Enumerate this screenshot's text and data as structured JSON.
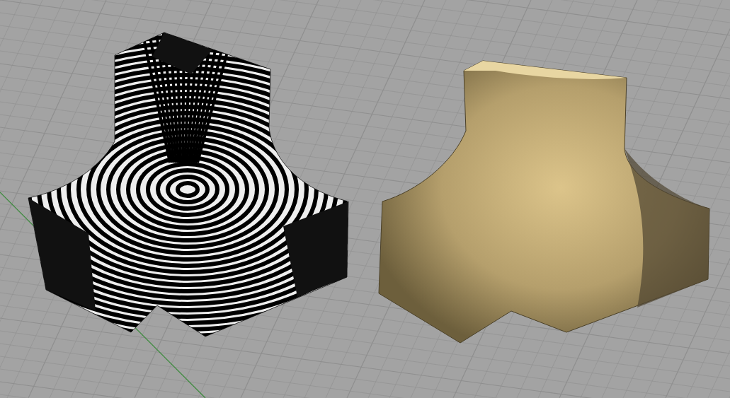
{
  "viewport": {
    "objects": [
      {
        "kind": "zebra"
      },
      {
        "kind": "shaded"
      }
    ]
  }
}
